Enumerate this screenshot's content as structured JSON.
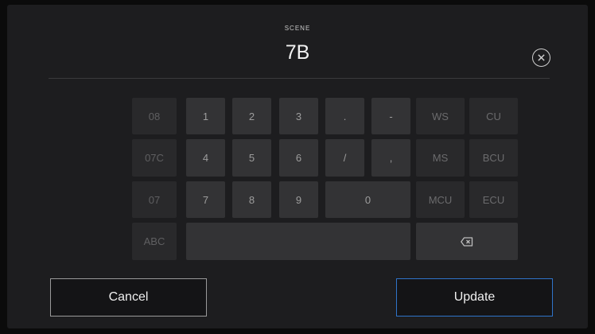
{
  "header": {
    "label": "SCENE",
    "value": "7B"
  },
  "keypad": {
    "history": [
      "08",
      "07C",
      "07"
    ],
    "digits": [
      "1",
      "2",
      "3",
      "4",
      "5",
      "6",
      "7",
      "8",
      "9",
      "0"
    ],
    "punct": [
      ".",
      "-",
      "/",
      ","
    ],
    "suffixes": [
      "WS",
      "CU",
      "MS",
      "BCU",
      "MCU",
      "ECU"
    ],
    "abc": "ABC"
  },
  "actions": {
    "cancel": "Cancel",
    "update": "Update"
  },
  "colors": {
    "background": "#1d1d1f",
    "key": "#333335",
    "accent": "#2f74c9"
  },
  "icons": {
    "clear": "circle-x-icon",
    "backspace": "backspace-icon"
  }
}
